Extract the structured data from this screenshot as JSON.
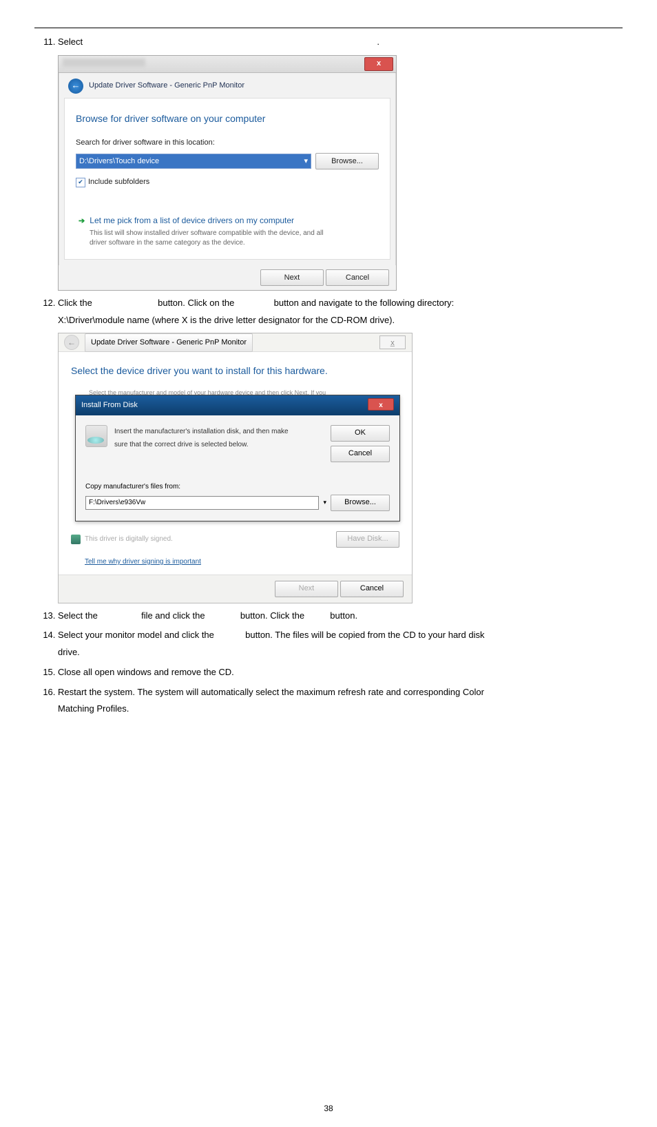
{
  "page_number": "38",
  "step11": {
    "number": "11.",
    "text_a": "Select",
    "text_b": "."
  },
  "dlg1": {
    "crumb": "Update Driver Software - Generic PnP Monitor",
    "heading": "Browse for driver software on your computer",
    "search_label": "Search for driver software in this location:",
    "path_value": "D:\\Drivers\\Touch device",
    "browse": "Browse...",
    "include_sub": "Include subfolders",
    "opt_title": "Let me pick from a list of device drivers on my computer",
    "opt_desc1": "This list will show installed driver software compatible with the device, and all",
    "opt_desc2": "driver software in the same category as the device.",
    "next": "Next",
    "cancel": "Cancel"
  },
  "step12": {
    "text_a": "Click the",
    "text_b": "button. Click on the",
    "text_c": "button and navigate to the following directory:",
    "line2": "X:\\Driver\\module name (where X is the drive letter designator for the CD-ROM drive)."
  },
  "dlg2": {
    "crumb": "Update Driver Software - Generic PnP Monitor",
    "heading": "Select the device driver you want to install for this hardware.",
    "subtext": "Select the manufacturer and model of your hardware device and then click Next. If you",
    "ifd_title": "Install From Disk",
    "ifd_text1": "Insert the manufacturer's installation disk, and then make",
    "ifd_text2": "sure that the correct drive is selected below.",
    "ok": "OK",
    "cancel": "Cancel",
    "copy_label": "Copy manufacturer's files from:",
    "copy_value": "F:\\Drivers\\e936Vw",
    "browse": "Browse...",
    "signed": "This driver is digitally signed.",
    "link": "Tell me why driver signing is important",
    "have_disk": "Have Disk...",
    "next": "Next"
  },
  "step13": {
    "a": "Select the",
    "b": "file and click the",
    "c": "button. Click the",
    "d": "button."
  },
  "step14": {
    "a": "Select your monitor model and click the",
    "b": "button. The files will be copied from the CD to your hard disk",
    "c": "drive."
  },
  "step15": "Close all open windows and remove the CD.",
  "step16": {
    "a": "Restart the system. The system will automatically select the maximum refresh rate and corresponding Color",
    "b": "Matching Profiles."
  }
}
